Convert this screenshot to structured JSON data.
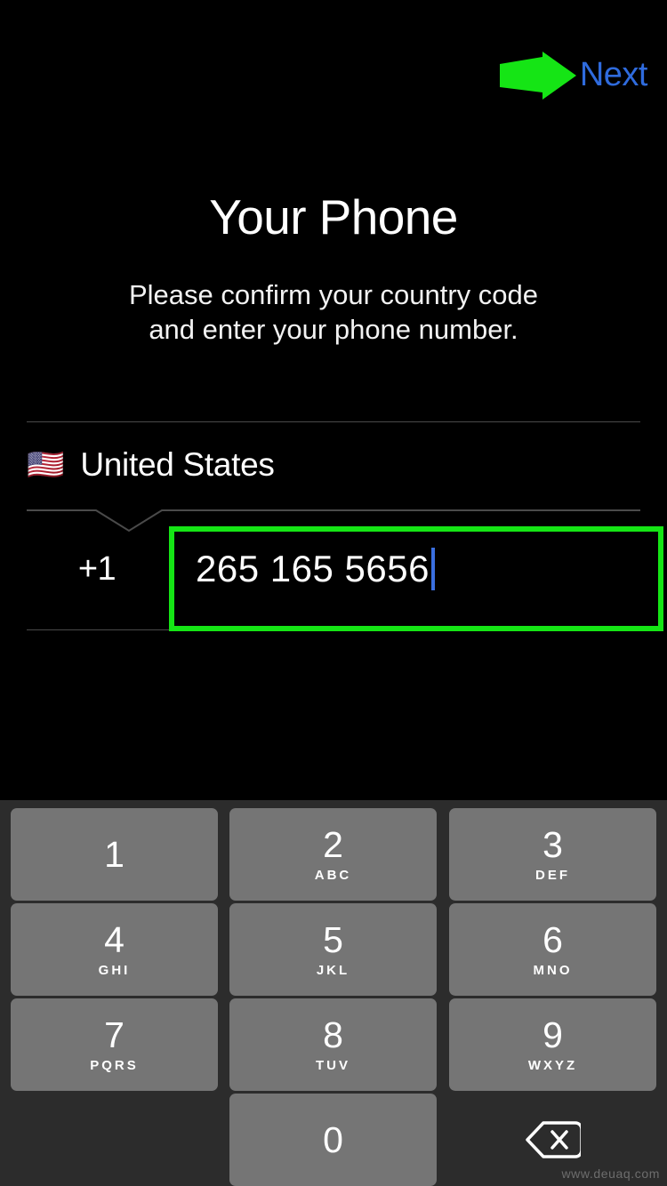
{
  "header": {
    "next_label": "Next",
    "next_color": "#2f6bdd",
    "annotation_arrow": "right-arrow-annotation",
    "annotation_color": "#15e515"
  },
  "page": {
    "title": "Your Phone",
    "subtitle_line1": "Please confirm your country code",
    "subtitle_line2": "and enter your phone number."
  },
  "form": {
    "country_flag": "🇺🇸",
    "country_name": "United States",
    "country_code": "+1",
    "phone_number": "265 165 5656",
    "phone_placeholder": "Phone number",
    "caret_color": "#3a6fe0",
    "highlight_color": "#15e515"
  },
  "keypad": {
    "background": "#2c2c2c",
    "key_color": "#757575",
    "keys": [
      {
        "digit": "1",
        "letters": ""
      },
      {
        "digit": "2",
        "letters": "ABC"
      },
      {
        "digit": "3",
        "letters": "DEF"
      },
      {
        "digit": "4",
        "letters": "GHI"
      },
      {
        "digit": "5",
        "letters": "JKL"
      },
      {
        "digit": "6",
        "letters": "MNO"
      },
      {
        "digit": "7",
        "letters": "PQRS"
      },
      {
        "digit": "8",
        "letters": "TUV"
      },
      {
        "digit": "9",
        "letters": "WXYZ"
      },
      {
        "digit": "0",
        "letters": ""
      }
    ],
    "backspace_icon": "backspace-delete-icon"
  },
  "watermark": {
    "text": "www.deuaq.com"
  }
}
